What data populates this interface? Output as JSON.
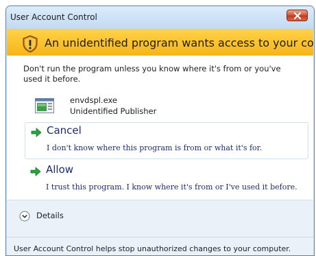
{
  "window": {
    "title": "User Account Control",
    "close_icon": "close-x"
  },
  "header": {
    "icon": "uac-shield",
    "text": "An unidentified program wants access to your computer",
    "color": "#f6b518"
  },
  "content": {
    "warning": "Don't run the program unless you know where it's from or you've used it before.",
    "program": {
      "name": "envdspl.exe",
      "publisher": "Unidentified Publisher",
      "icon": "program-icon"
    },
    "options": [
      {
        "id": "cancel",
        "title": "Cancel",
        "description": "I don't know where this program is from or what it's for.",
        "icon": "green-arrow"
      },
      {
        "id": "allow",
        "title": "Allow",
        "description": "I trust this program. I know where it's from or I've used it before.",
        "icon": "green-arrow"
      }
    ]
  },
  "details": {
    "label": "Details",
    "expanded": false
  },
  "footer": {
    "text": "User Account Control helps stop unauthorized changes to your computer."
  }
}
